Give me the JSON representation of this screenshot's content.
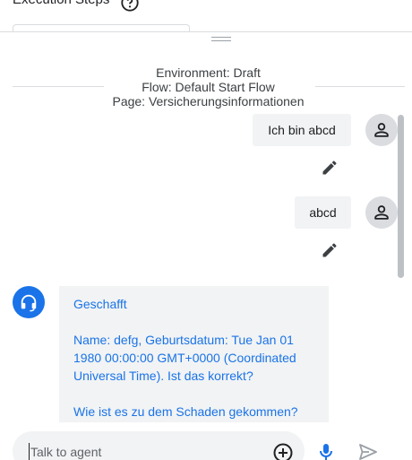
{
  "header": {
    "steps_title": "Execution Steps",
    "help_icon": "help-circle-icon"
  },
  "context": {
    "environment": "Environment: Draft",
    "flow": "Flow: Default Start Flow",
    "page": "Page: Versicherungsinformationen"
  },
  "messages": [
    {
      "role": "user",
      "text": "Ich bin abcd",
      "icon": "person-icon",
      "action_icon": "edit-icon"
    },
    {
      "role": "user",
      "text": "abcd",
      "icon": "person-icon",
      "action_icon": "edit-icon"
    },
    {
      "role": "agent",
      "icon": "headset-icon",
      "paragraphs": [
        "Geschafft",
        "Name: defg, Geburtsdatum: Tue Jan 01 1980 00:00:00 GMT+0000 (Coordinated Universal Time). Ist das korrekt?",
        "Wie ist es zu dem Schaden gekommen?"
      ]
    }
  ],
  "input": {
    "placeholder": "Talk to agent",
    "value": ""
  },
  "colors": {
    "accent": "#1a73e8",
    "bubble": "#f1f3f4",
    "avatar_bg": "#dadce0"
  }
}
